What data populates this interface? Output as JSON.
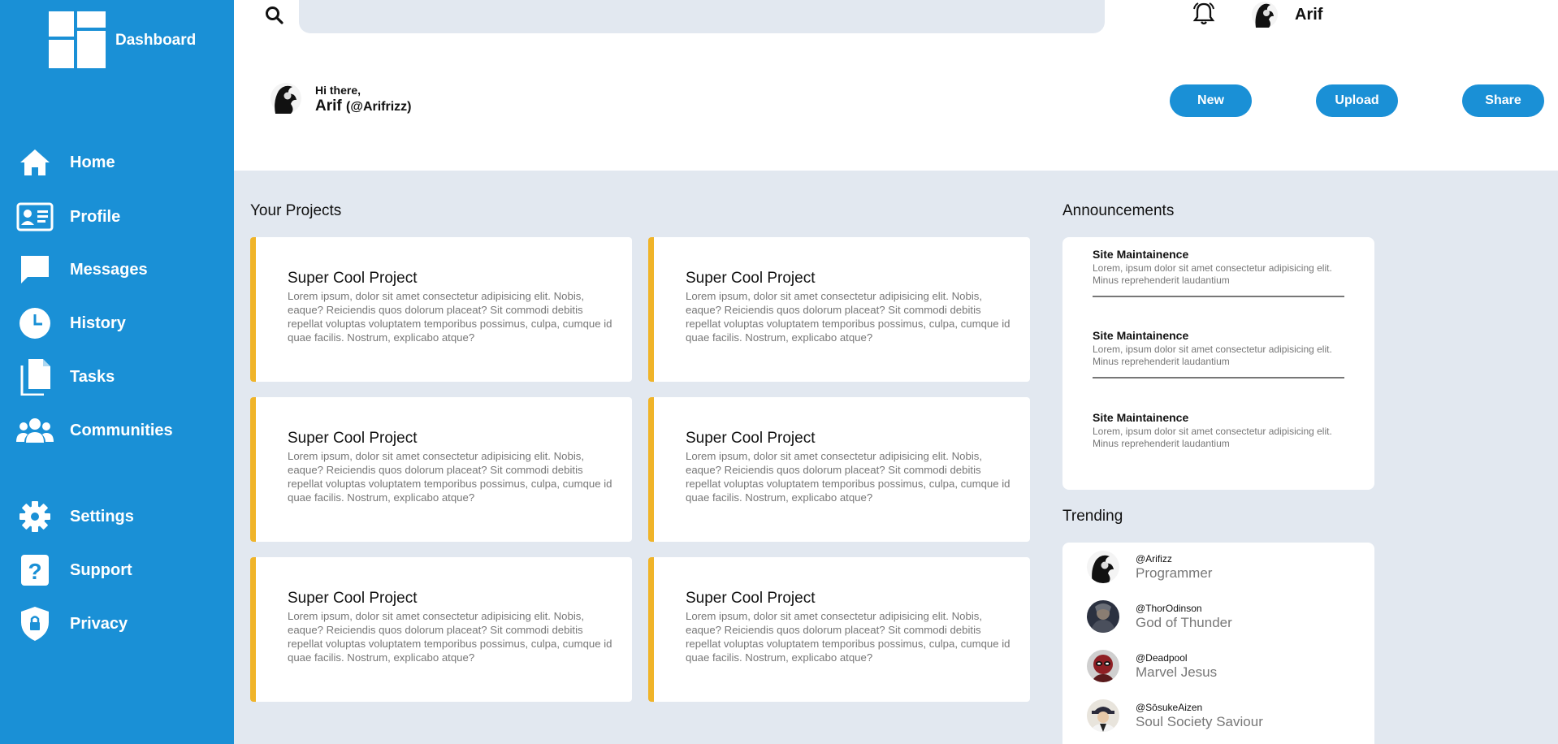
{
  "sidebar": {
    "brand": "Dashboard",
    "items": [
      {
        "label": "Home",
        "icon": "home-icon"
      },
      {
        "label": "Profile",
        "icon": "id-card-icon"
      },
      {
        "label": "Messages",
        "icon": "chat-icon"
      },
      {
        "label": "History",
        "icon": "clock-icon"
      },
      {
        "label": "Tasks",
        "icon": "file-icon"
      },
      {
        "label": "Communities",
        "icon": "users-icon"
      },
      {
        "label": "Settings",
        "icon": "gear-icon"
      },
      {
        "label": "Support",
        "icon": "question-icon"
      },
      {
        "label": "Privacy",
        "icon": "shield-icon"
      }
    ]
  },
  "header": {
    "search": {
      "value": "",
      "placeholder": ""
    },
    "user": "Arif"
  },
  "greeting": {
    "hi": "Hi there,",
    "name": "Arif",
    "handle": "(@Arifrizz)"
  },
  "actions": {
    "new": "New",
    "upload": "Upload",
    "share": "Share"
  },
  "projects": {
    "title": "Your Projects",
    "items": [
      {
        "title": "Super Cool Project",
        "desc": "Lorem ipsum, dolor sit amet consectetur adipisicing elit. Nobis, eaque? Reiciendis quos dolorum placeat? Sit commodi debitis repellat voluptas voluptatem temporibus possimus, culpa, cumque id quae facilis. Nostrum, explicabo atque?"
      },
      {
        "title": "Super Cool Project",
        "desc": "Lorem ipsum, dolor sit amet consectetur adipisicing elit. Nobis, eaque? Reiciendis quos dolorum placeat? Sit commodi debitis repellat voluptas voluptatem temporibus possimus, culpa, cumque id quae facilis. Nostrum, explicabo atque?"
      },
      {
        "title": "Super Cool Project",
        "desc": "Lorem ipsum, dolor sit amet consectetur adipisicing elit. Nobis, eaque? Reiciendis quos dolorum placeat? Sit commodi debitis repellat voluptas voluptatem temporibus possimus, culpa, cumque id quae facilis. Nostrum, explicabo atque?"
      },
      {
        "title": "Super Cool Project",
        "desc": "Lorem ipsum, dolor sit amet consectetur adipisicing elit. Nobis, eaque? Reiciendis quos dolorum placeat? Sit commodi debitis repellat voluptas voluptatem temporibus possimus, culpa, cumque id quae facilis. Nostrum, explicabo atque?"
      },
      {
        "title": "Super Cool Project",
        "desc": "Lorem ipsum, dolor sit amet consectetur adipisicing elit. Nobis, eaque? Reiciendis quos dolorum placeat? Sit commodi debitis repellat voluptas voluptatem temporibus possimus, culpa, cumque id quae facilis. Nostrum, explicabo atque?"
      },
      {
        "title": "Super Cool Project",
        "desc": "Lorem ipsum, dolor sit amet consectetur adipisicing elit. Nobis, eaque? Reiciendis quos dolorum placeat? Sit commodi debitis repellat voluptas voluptatem temporibus possimus, culpa, cumque id quae facilis. Nostrum, explicabo atque?"
      }
    ]
  },
  "announcements": {
    "title": "Announcements",
    "items": [
      {
        "title": "Site Maintainence",
        "desc": "Lorem, ipsum dolor sit amet consectetur adipisicing elit. Minus reprehenderit laudantium"
      },
      {
        "title": "Site Maintainence",
        "desc": "Lorem, ipsum dolor sit amet consectetur adipisicing elit. Minus reprehenderit laudantium"
      },
      {
        "title": "Site Maintainence",
        "desc": "Lorem, ipsum dolor sit amet consectetur adipisicing elit. Minus reprehenderit laudantium"
      }
    ]
  },
  "trending": {
    "title": "Trending",
    "items": [
      {
        "handle": "@Arifizz",
        "tagline": "Programmer"
      },
      {
        "handle": "@ThorOdinson",
        "tagline": "God of Thunder"
      },
      {
        "handle": "@Deadpool",
        "tagline": "Marvel Jesus"
      },
      {
        "handle": "@SōsukeAizen",
        "tagline": "Soul Society Saviour"
      }
    ]
  },
  "colors": {
    "accent": "#1a90d6",
    "card_border": "#f0b429",
    "background": "#e2e8f0"
  }
}
